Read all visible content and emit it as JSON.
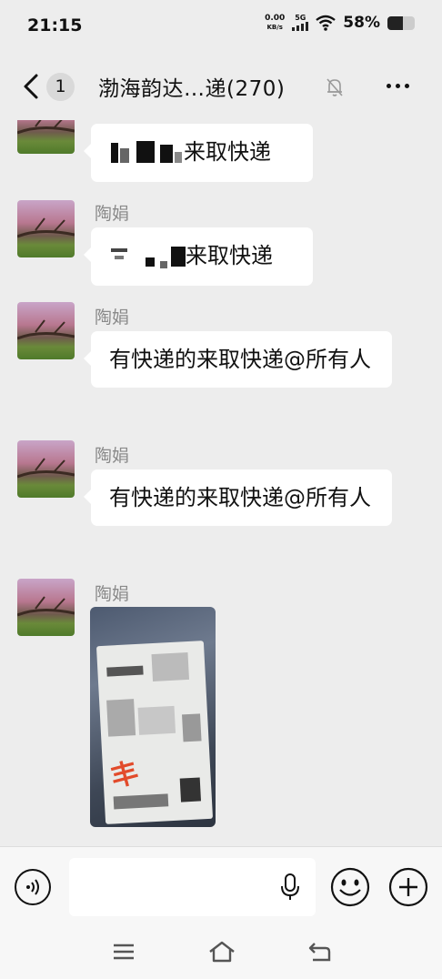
{
  "status_bar": {
    "time": "21:15",
    "net_speed_value": "0.00",
    "net_speed_unit": "KB/s",
    "signal_label": "5G",
    "battery_percent": "58%",
    "battery_level": 0.58
  },
  "header": {
    "unread_count": "1",
    "title": "渤海韵达…递(270)"
  },
  "messages": [
    {
      "sender": "",
      "text_suffix": "来取快递"
    },
    {
      "sender": "陶娟",
      "text_suffix": "来取快递"
    },
    {
      "sender": "陶娟",
      "text": "有快递的来取快递@所有人"
    },
    {
      "sender": "陶娟",
      "text": "有快递的来取快递@所有人"
    },
    {
      "sender": "陶娟",
      "type": "image"
    }
  ],
  "input_bar": {
    "placeholder": ""
  },
  "icons": {
    "back": "chevron-left-icon",
    "mute": "bell-muted-icon",
    "more": "more-dots-icon",
    "voice": "voice-icon",
    "mic": "microphone-icon",
    "emoji": "smiley-icon",
    "plus": "plus-circle-icon",
    "menu": "menu-icon",
    "home": "home-icon",
    "back_nav": "back-arrow-icon"
  }
}
